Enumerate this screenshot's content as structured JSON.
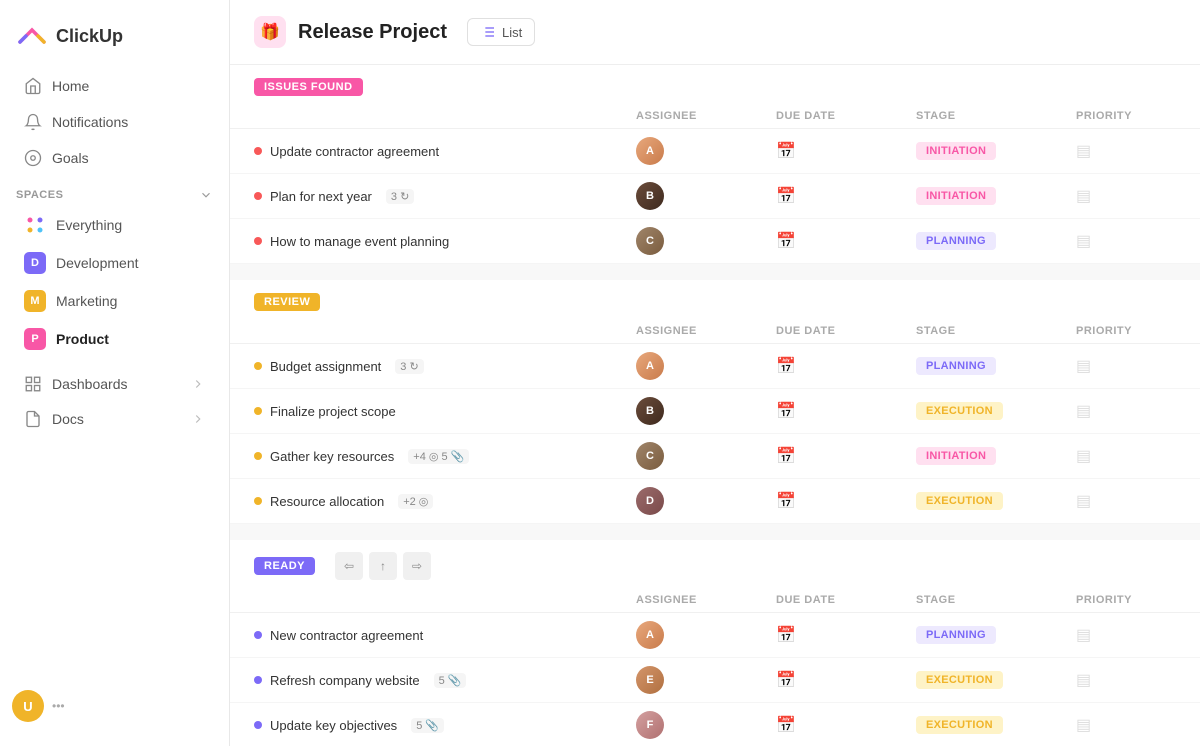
{
  "logo": {
    "text": "ClickUp"
  },
  "nav": {
    "home": "Home",
    "notifications": "Notifications",
    "goals": "Goals"
  },
  "spaces": {
    "header": "Spaces",
    "items": [
      {
        "id": "everything",
        "label": "Everything",
        "color": null
      },
      {
        "id": "development",
        "label": "Development",
        "color": "#7c6af7",
        "initial": "D"
      },
      {
        "id": "marketing",
        "label": "Marketing",
        "color": "#f0b429",
        "initial": "M"
      },
      {
        "id": "product",
        "label": "Product",
        "color": "#f857a6",
        "initial": "P"
      }
    ]
  },
  "sidebar_sections": [
    {
      "id": "dashboards",
      "label": "Dashboards"
    },
    {
      "id": "docs",
      "label": "Docs"
    }
  ],
  "project": {
    "title": "Release Project",
    "view": "List"
  },
  "table_headers": {
    "assignee": "ASSIGNEE",
    "due_date": "DUE DATE",
    "stage": "STAGE",
    "priority": "PRIORITY"
  },
  "sections": [
    {
      "id": "issues",
      "badge": "ISSUES FOUND",
      "badge_class": "badge-issues",
      "tasks": [
        {
          "name": "Update contractor agreement",
          "dot": "dot-red",
          "badge": null,
          "assignee_color": "#e8a87c",
          "assignee_initials": "A",
          "stage": "INITIATION",
          "stage_class": "stage-initiation"
        },
        {
          "name": "Plan for next year",
          "dot": "dot-red",
          "badge": "3",
          "badge_icon": "↻",
          "assignee_color": "#5c4b3e",
          "assignee_initials": "B",
          "stage": "INITIATION",
          "stage_class": "stage-initiation"
        },
        {
          "name": "How to manage event planning",
          "dot": "dot-red",
          "badge": null,
          "assignee_color": "#8b7355",
          "assignee_initials": "C",
          "stage": "PLANNING",
          "stage_class": "stage-planning"
        }
      ]
    },
    {
      "id": "review",
      "badge": "REVIEW",
      "badge_class": "badge-review",
      "tasks": [
        {
          "name": "Budget assignment",
          "dot": "dot-yellow",
          "badge": "3",
          "badge_icon": "↻",
          "assignee_color": "#e8a87c",
          "assignee_initials": "A",
          "stage": "PLANNING",
          "stage_class": "stage-planning"
        },
        {
          "name": "Finalize project scope",
          "dot": "dot-yellow",
          "badge": null,
          "assignee_color": "#5c4b3e",
          "assignee_initials": "B",
          "stage": "EXECUTION",
          "stage_class": "stage-execution"
        },
        {
          "name": "Gather key resources",
          "dot": "dot-yellow",
          "badge": "+4",
          "badge_extra": "5",
          "badge_icon": "📎",
          "assignee_color": "#8b7355",
          "assignee_initials": "C",
          "stage": "INITIATION",
          "stage_class": "stage-initiation"
        },
        {
          "name": "Resource allocation",
          "dot": "dot-yellow",
          "badge": "+2",
          "badge_icon": "◎",
          "assignee_color": "#7a5c58",
          "assignee_initials": "D",
          "stage": "EXECUTION",
          "stage_class": "stage-execution"
        }
      ]
    },
    {
      "id": "ready",
      "badge": "READY",
      "badge_class": "badge-ready",
      "tasks": [
        {
          "name": "New contractor agreement",
          "dot": "dot-blue",
          "badge": null,
          "assignee_color": "#e8a87c",
          "assignee_initials": "A",
          "stage": "PLANNING",
          "stage_class": "stage-planning"
        },
        {
          "name": "Refresh company website",
          "dot": "dot-blue",
          "badge": "5",
          "badge_icon": "📎",
          "assignee_color": "#c9956c",
          "assignee_initials": "E",
          "stage": "EXECUTION",
          "stage_class": "stage-execution"
        },
        {
          "name": "Update key objectives",
          "dot": "dot-blue",
          "badge": "5",
          "badge_icon": "📎",
          "assignee_color": "#d4a0a0",
          "assignee_initials": "F",
          "stage": "EXECUTION",
          "stage_class": "stage-execution"
        }
      ]
    }
  ]
}
